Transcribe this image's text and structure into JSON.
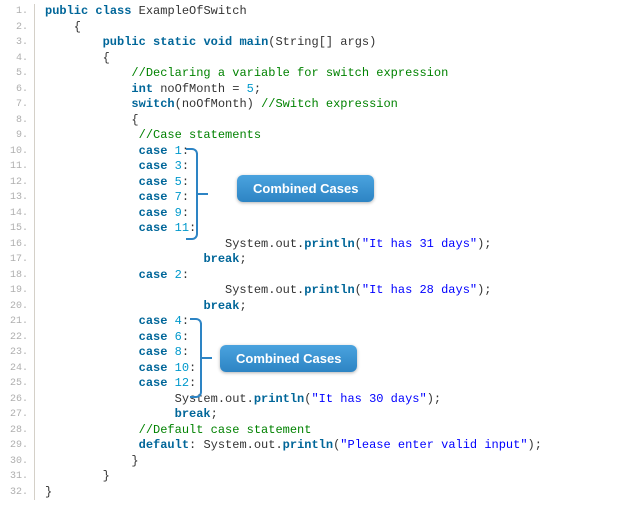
{
  "lines": [
    {
      "n": "1.",
      "html": "<span class='kw'>public</span> <span class='kw'>class</span> <span class='cls'>ExampleOfSwitch</span>",
      "indent": 0
    },
    {
      "n": "2.",
      "html": "{",
      "indent": 1
    },
    {
      "n": "3.",
      "html": "<span class='kw'>public</span> <span class='kw'>static</span> <span class='kw'>void</span> <span class='main'>main</span>(String[] args)",
      "indent": 2
    },
    {
      "n": "4.",
      "html": "{",
      "indent": 2
    },
    {
      "n": "5.",
      "html": "<span class='comment'>//Declaring a variable for switch expression</span>",
      "indent": 3
    },
    {
      "n": "6.",
      "html": "<span class='kw'>int</span> noOfMonth = <span class='num'>5</span>;",
      "indent": 3
    },
    {
      "n": "7.",
      "html": "<span class='kw'>switch</span>(noOfMonth) <span class='comment'>//Switch expression</span>",
      "indent": 3
    },
    {
      "n": "8.",
      "html": "{",
      "indent": 3
    },
    {
      "n": "9.",
      "html": " <span class='comment'>//Case statements</span>",
      "indent": 3
    },
    {
      "n": "10.",
      "html": " <span class='kw'>case</span> <span class='num'>1</span>:",
      "indent": 3
    },
    {
      "n": "11.",
      "html": " <span class='kw'>case</span> <span class='num'>3</span>:",
      "indent": 3
    },
    {
      "n": "12.",
      "html": " <span class='kw'>case</span> <span class='num'>5</span>:",
      "indent": 3
    },
    {
      "n": "13.",
      "html": " <span class='kw'>case</span> <span class='num'>7</span>:",
      "indent": 3
    },
    {
      "n": "14.",
      "html": " <span class='kw'>case</span> <span class='num'>9</span>:",
      "indent": 3
    },
    {
      "n": "15.",
      "html": " <span class='kw'>case</span> <span class='num'>11</span>:",
      "indent": 3
    },
    {
      "n": "16.",
      "html": "     System.out.<span class='fn'>println</span>(<span class='str'>\"It has 31 days\"</span>);",
      "indent": 5
    },
    {
      "n": "17.",
      "html": "  <span class='kw'>break</span>;",
      "indent": 5
    },
    {
      "n": "18.",
      "html": " <span class='kw'>case</span> <span class='num'>2</span>:",
      "indent": 3
    },
    {
      "n": "19.",
      "html": "     System.out.<span class='fn'>println</span>(<span class='str'>\"It has 28 days\"</span>);",
      "indent": 5
    },
    {
      "n": "20.",
      "html": "  <span class='kw'>break</span>;",
      "indent": 5
    },
    {
      "n": "21.",
      "html": " <span class='kw'>case</span> <span class='num'>4</span>:",
      "indent": 3
    },
    {
      "n": "22.",
      "html": " <span class='kw'>case</span> <span class='num'>6</span>:",
      "indent": 3
    },
    {
      "n": "23.",
      "html": " <span class='kw'>case</span> <span class='num'>8</span>:",
      "indent": 3
    },
    {
      "n": "24.",
      "html": " <span class='kw'>case</span> <span class='num'>10</span>:",
      "indent": 3
    },
    {
      "n": "25.",
      "html": " <span class='kw'>case</span> <span class='num'>12</span>:",
      "indent": 3
    },
    {
      "n": "26.",
      "html": "  System.out.<span class='fn'>println</span>(<span class='str'>\"It has 30 days\"</span>);",
      "indent": 4
    },
    {
      "n": "27.",
      "html": "  <span class='kw'>break</span>;",
      "indent": 4
    },
    {
      "n": "28.",
      "html": " <span class='comment'>//Default case statement</span>",
      "indent": 3
    },
    {
      "n": "29.",
      "html": " <span class='kw'>default</span>: System.out.<span class='fn'>println</span>(<span class='str'>\"Please enter valid input\"</span>);",
      "indent": 3
    },
    {
      "n": "30.",
      "html": "}",
      "indent": 3
    },
    {
      "n": "31.",
      "html": "}",
      "indent": 2
    },
    {
      "n": "32.",
      "html": "}",
      "indent": 0
    }
  ],
  "annotations": {
    "badge1": "Combined Cases",
    "badge2": "Combined Cases"
  }
}
